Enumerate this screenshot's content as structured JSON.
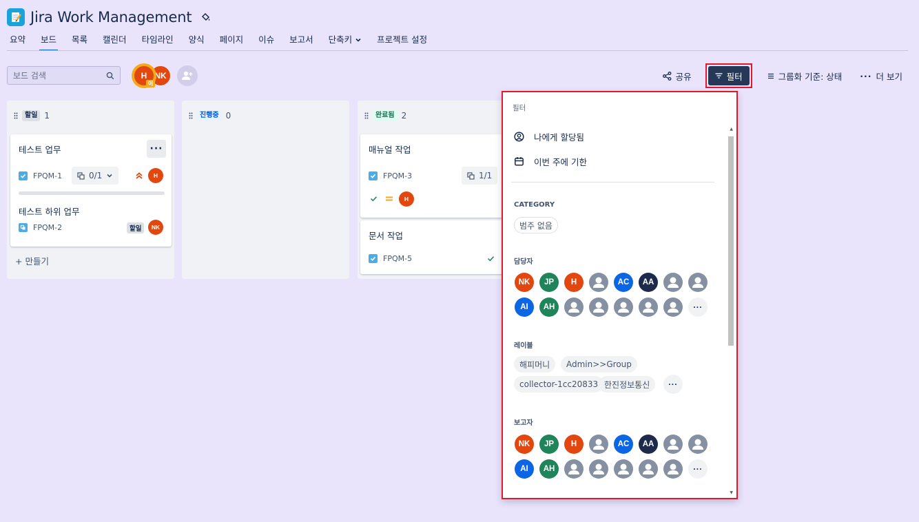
{
  "app": {
    "title": "Jira Work Management"
  },
  "nav": {
    "tabs": [
      {
        "label": "요약"
      },
      {
        "label": "보드"
      },
      {
        "label": "목록"
      },
      {
        "label": "캘린더"
      },
      {
        "label": "타임라인"
      },
      {
        "label": "양식"
      },
      {
        "label": "페이지"
      },
      {
        "label": "이슈"
      },
      {
        "label": "보고서"
      },
      {
        "label": "단축키"
      },
      {
        "label": "프로젝트 설정"
      }
    ],
    "active_tab": "보드"
  },
  "toolbar": {
    "search_placeholder": "보드 검색",
    "avatars": [
      {
        "initials": "H",
        "badge": "이"
      },
      {
        "initials": "NK"
      }
    ],
    "share_label": "공유",
    "filter_label": "필터",
    "group_label": "그룹화 기준: 상태",
    "more_label": "더 보기"
  },
  "columns": [
    {
      "status": "할일",
      "count": "1",
      "cards": [
        {
          "title": "테스트 업무",
          "key": "FPQM-1",
          "child_count": "0/1",
          "priority": "highest",
          "assignee": "H",
          "subtask": {
            "title": "테스트 하위 업무",
            "key": "FPQM-2",
            "status": "할일",
            "assignee": "NK"
          }
        }
      ],
      "create_label": "+ 만들기"
    },
    {
      "status": "진행중",
      "count": "0",
      "cards": []
    },
    {
      "status": "완료됨",
      "count": "2",
      "cards": [
        {
          "title": "매뉴얼 작업",
          "key": "FPQM-3",
          "child_count": "1/1",
          "priority": "medium",
          "assignee": "H"
        },
        {
          "title": "문서 작업",
          "key": "FPQM-5"
        }
      ]
    }
  ],
  "filter_panel": {
    "title": "필터",
    "quick_filters": [
      {
        "label": "나에게 할당됨"
      },
      {
        "label": "이번 주에 기한"
      }
    ],
    "category": {
      "heading": "CATEGORY",
      "chips": [
        "범주 없음"
      ]
    },
    "assignee": {
      "heading": "담당자",
      "row1": [
        "NK",
        "JP",
        "H",
        "",
        "AC",
        "AA",
        "",
        ""
      ],
      "row2": [
        "AI",
        "AH",
        "",
        "",
        "",
        "",
        "",
        "···"
      ]
    },
    "labels": {
      "heading": "레이블",
      "chips": [
        "해피머니",
        "Admin>>Group",
        "collector-1cc20833",
        "한진정보통신"
      ],
      "more": "···"
    },
    "reporter": {
      "heading": "보고자",
      "row1": [
        "NK",
        "JP",
        "H",
        "",
        "AC",
        "AA",
        "",
        ""
      ],
      "row2": [
        "AI",
        "AH",
        "",
        "",
        "",
        "",
        "",
        "···"
      ]
    }
  },
  "colors": {
    "accent": "#0c66e4",
    "highlight": "#e0182d",
    "background": "#e9e4fc",
    "filter_button": "#253858"
  }
}
